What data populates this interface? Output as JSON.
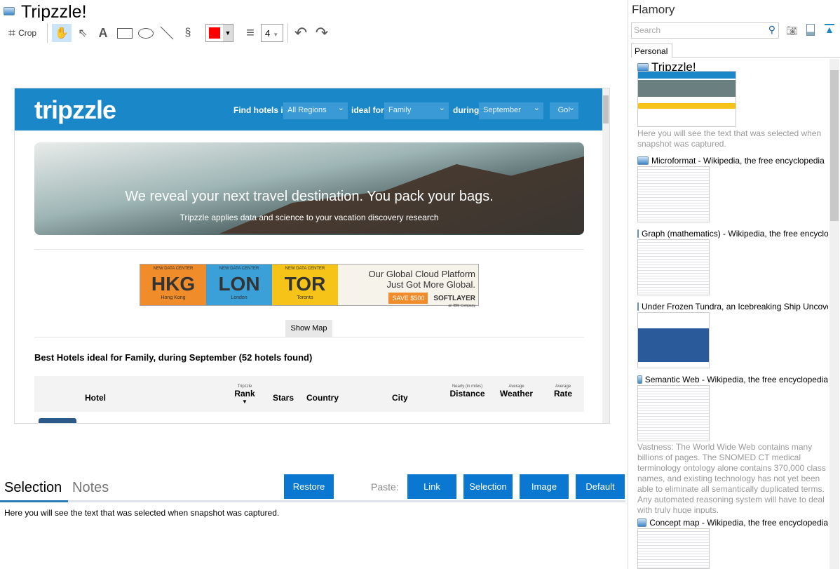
{
  "window": {
    "title": "Tripzzle!"
  },
  "toolbar": {
    "crop_label": "Crop",
    "line_width": "4",
    "color": "#ff0000"
  },
  "snapshot": {
    "logo": "tripzzle",
    "find_label": "Find hotels in",
    "region": "All Regions",
    "ideal_label": "ideal for",
    "ideal": "Family",
    "during_label": "during",
    "month": "September",
    "go": "Go!",
    "hero_title": "We reveal your next travel destination. You pack your bags.",
    "hero_sub": "Tripzzle applies data and science to your vacation discovery research",
    "ad": {
      "tickets": [
        {
          "tag": "NEW DATA CENTER",
          "code": "HKG",
          "city": "Hong Kong",
          "color": "#f08c2a"
        },
        {
          "tag": "NEW DATA CENTER",
          "code": "LON",
          "city": "London",
          "color": "#3ba0d8"
        },
        {
          "tag": "NEW DATA CENTER",
          "code": "TOR",
          "city": "Toronto",
          "color": "#f6c419"
        }
      ],
      "headline1": "Our Global Cloud Platform",
      "headline2": "Just Got More Global.",
      "save": "SAVE $500",
      "brand": "SOFTLAYER",
      "brand_sub": "an IBM Company"
    },
    "show_map": "Show Map",
    "results_heading": "Best Hotels ideal for Family, during September (52 hotels found)",
    "columns": {
      "hotel": "Hotel",
      "rank_top": "Tripzzle",
      "rank": "Rank",
      "stars": "Stars",
      "country": "Country",
      "city": "City",
      "distance_top": "Nearly (in miles)",
      "distance": "Distance",
      "weather_top": "Average",
      "weather": "Weather",
      "rate_top": "Average",
      "rate": "Rate"
    }
  },
  "bottom": {
    "tab_selection": "Selection",
    "tab_notes": "Notes",
    "restore": "Restore",
    "paste_label": "Paste:",
    "paste_link": "Link",
    "paste_selection": "Selection",
    "paste_image": "Image",
    "paste_default": "Default",
    "content": "Here you will see the text that was selected when snapshot was captured."
  },
  "sidebar": {
    "title": "Flamory",
    "search_placeholder": "Search",
    "tab": "Personal",
    "items": [
      {
        "title": "Tripzzle!",
        "desc": "Here you will see the text that was selected when snapshot was captured."
      },
      {
        "title": "Microformat - Wikipedia, the free encyclopedia"
      },
      {
        "title": "Graph (mathematics) - Wikipedia, the free encyclopedia"
      },
      {
        "title": "Under Frozen Tundra, an Icebreaking Ship Uncovers"
      },
      {
        "title": "Semantic Web - Wikipedia, the free encyclopedia",
        "desc": "Vastness: The World Wide Web contains many billions of pages. The SNOMED CT medical terminology ontology alone contains 370,000 class names, and existing technology has not yet been able to eliminate all semantically duplicated terms. Any automated reasoning system will have to deal with truly huge inputs."
      },
      {
        "title": "Concept map - Wikipedia, the free encyclopedia"
      }
    ]
  }
}
